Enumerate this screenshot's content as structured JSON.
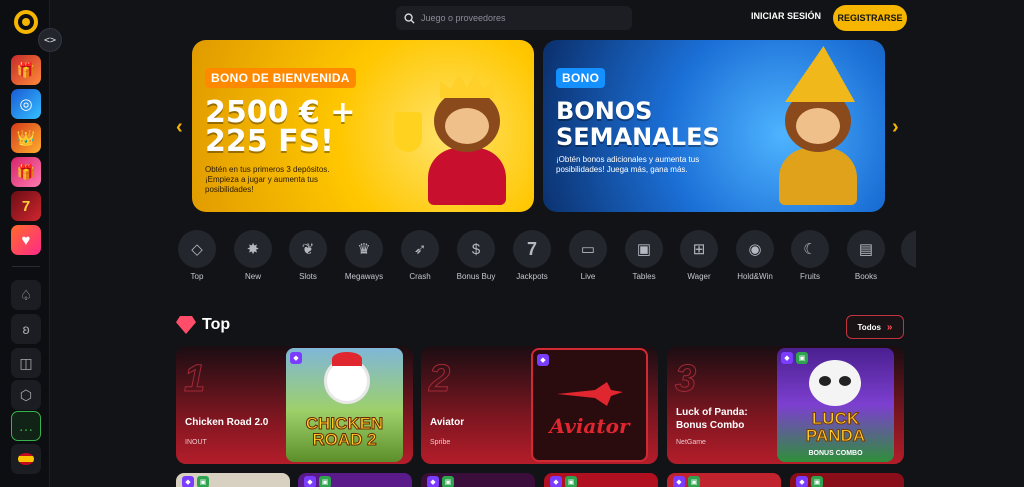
{
  "topbar": {
    "search_placeholder": "Juego o proveedores",
    "login_label": "INICIAR SESIÓN",
    "register_label": "REGISTRARSE"
  },
  "sidebar": {
    "toggle_glyph": "<>",
    "items": [
      {
        "name": "promo-gift-icon",
        "glyph": "🎁"
      },
      {
        "name": "wheel-icon",
        "glyph": "◎"
      },
      {
        "name": "crown-fire-icon",
        "glyph": "👑"
      },
      {
        "name": "gift-box-icon",
        "glyph": "🎁"
      },
      {
        "name": "sevens-icon",
        "glyph": "7"
      },
      {
        "name": "heart-icon",
        "glyph": "♥"
      }
    ],
    "nav": [
      {
        "name": "spade-icon",
        "glyph": "♤"
      },
      {
        "name": "cherries-icon",
        "glyph": "ʚ"
      },
      {
        "name": "live-icon",
        "glyph": "◫"
      },
      {
        "name": "dice-icon",
        "glyph": "⬡"
      },
      {
        "name": "chat-icon",
        "glyph": "…"
      },
      {
        "name": "spain-flag-icon",
        "glyph": ""
      }
    ]
  },
  "banners": [
    {
      "tag": "BONO DE BIENVENIDA",
      "title_line1": "2500 € +",
      "title_line2": "225 FS!",
      "subtitle": "Obtén en tus primeros 3 depósitos. ¡Empieza a jugar y aumenta tus posibilidades!"
    },
    {
      "tag": "BONO",
      "title_line1": "BONOS",
      "title_line2": "SEMANALES",
      "subtitle": "¡Obtén bonos adicionales y aumenta tus posibilidades! Juega más, gana más."
    }
  ],
  "categories": [
    {
      "label": "Top",
      "icon": "diamond-icon",
      "glyph": "◇"
    },
    {
      "label": "New",
      "icon": "new-badge-icon",
      "glyph": "✸"
    },
    {
      "label": "Slots",
      "icon": "cherries-icon",
      "glyph": "❦"
    },
    {
      "label": "Megaways",
      "icon": "crown-icon",
      "glyph": "♛"
    },
    {
      "label": "Crash",
      "icon": "rocket-icon",
      "glyph": "➶"
    },
    {
      "label": "Bonus Buy",
      "icon": "money-bag-icon",
      "glyph": "$"
    },
    {
      "label": "Jackpots",
      "icon": "seven-icon",
      "glyph": "7"
    },
    {
      "label": "Live",
      "icon": "live-icon",
      "glyph": "▭"
    },
    {
      "label": "Tables",
      "icon": "cards-icon",
      "glyph": "▣"
    },
    {
      "label": "Wager",
      "icon": "gift-icon",
      "glyph": "⊞"
    },
    {
      "label": "Hold&Win",
      "icon": "coins-icon",
      "glyph": "◉"
    },
    {
      "label": "Fruits",
      "icon": "banana-icon",
      "glyph": "☾"
    },
    {
      "label": "Books",
      "icon": "book-icon",
      "glyph": "▤"
    }
  ],
  "top_section": {
    "title": "Top",
    "all_label": "Todos",
    "all_glyph": "»",
    "games": [
      {
        "rank": "1",
        "name": "Chicken Road 2.0",
        "provider": "INOUT",
        "thumb_text": "CHICKEN ROAD 2"
      },
      {
        "rank": "2",
        "name": "Aviator",
        "provider": "Spribe",
        "thumb_text": "Aviator"
      },
      {
        "rank": "3",
        "name": "Luck of Panda: Bonus Combo",
        "provider": "NetGame",
        "thumb_text": "LUCK PANDA",
        "thumb_sub": "BONUS COMBO"
      }
    ]
  },
  "colors": {
    "accent": "#f5b500",
    "background": "#121316",
    "card_red": "#b41d2a"
  }
}
